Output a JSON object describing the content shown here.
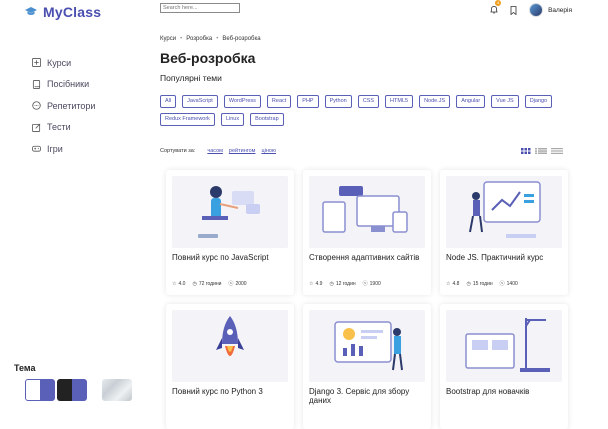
{
  "app": {
    "name": "MyClass"
  },
  "sidebar": {
    "items": [
      {
        "label": "Курси",
        "icon": "plus-square-icon"
      },
      {
        "label": "Посібники",
        "icon": "book-icon"
      },
      {
        "label": "Репетитори",
        "icon": "chat-icon"
      },
      {
        "label": "Тести",
        "icon": "edit-icon"
      },
      {
        "label": "Ігри",
        "icon": "gamepad-icon"
      }
    ],
    "theme_title": "Тема"
  },
  "header": {
    "search_placeholder": "Search here...",
    "notifications": "4",
    "user_name": "Валерія"
  },
  "breadcrumbs": [
    "Курси",
    "Розробка",
    "Веб-розробка"
  ],
  "page": {
    "title": "Веб-розробка",
    "popular_label": "Популярні теми"
  },
  "tags": [
    "All",
    "JavaScript",
    "WordPress",
    "React",
    "PHP",
    "Python",
    "CSS",
    "HTML5",
    "Node.JS",
    "Angular",
    "Vue JS",
    "Django",
    "Redux Framework",
    "Linux",
    "Bootstrap"
  ],
  "sort": {
    "label": "Сортувати за:",
    "options": [
      "часом",
      "рейтингом",
      "ціною"
    ]
  },
  "courses": [
    {
      "title": "Повний курс по JavaScript",
      "rating": "4.0",
      "duration": "72 години",
      "price": "2000"
    },
    {
      "title": "Створення адаптивних сайтів",
      "rating": "4.9",
      "duration": "12 годин",
      "price": "1900"
    },
    {
      "title": "Node JS. Практичний курс",
      "rating": "4.8",
      "duration": "15 годин",
      "price": "1400"
    },
    {
      "title": "Повний курс по Python 3",
      "rating": "",
      "duration": "",
      "price": ""
    },
    {
      "title": "Django 3. Сервіс для збору даних",
      "rating": "",
      "duration": "",
      "price": ""
    },
    {
      "title": "Bootstrap для новачків",
      "rating": "",
      "duration": "",
      "price": ""
    }
  ],
  "colors": {
    "accent": "#4a4fb0",
    "card_bg": "#f4f4f8"
  }
}
